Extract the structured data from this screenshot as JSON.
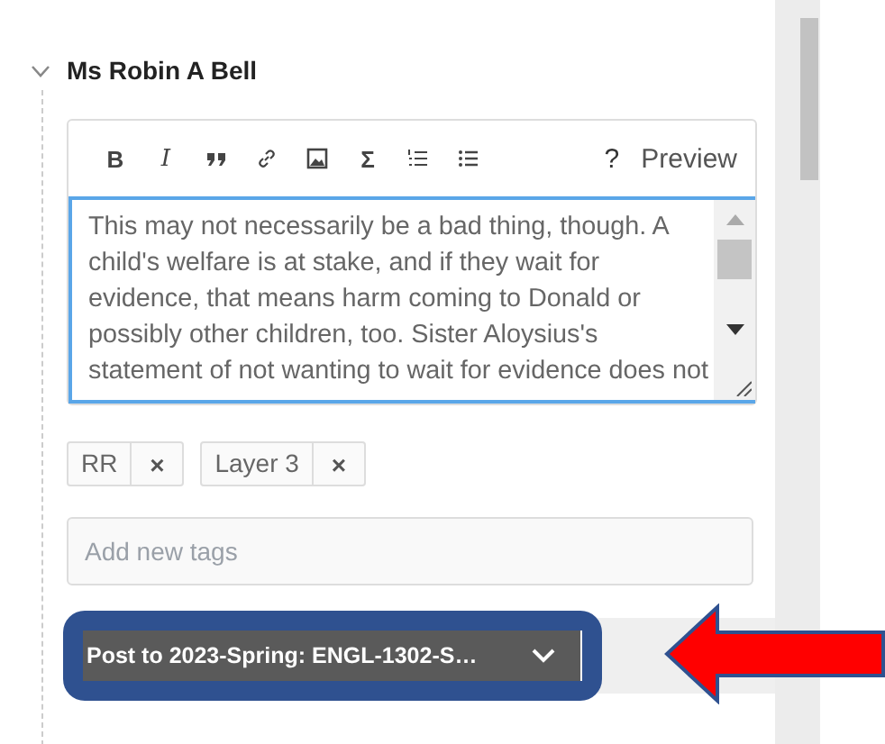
{
  "comment_author": {
    "name": "Ms Robin A Bell",
    "expanded": true
  },
  "toolbar": [
    {
      "kind": "bold",
      "label": "B"
    },
    {
      "kind": "italic",
      "label": "I"
    },
    {
      "kind": "quote"
    },
    {
      "kind": "link"
    },
    {
      "kind": "image"
    },
    {
      "kind": "text",
      "label": "Σ"
    },
    {
      "kind": "ordered-list"
    },
    {
      "kind": "bullet-list"
    }
  ],
  "help": "?",
  "preview": "Preview",
  "body": "This may not necessarily be a bad thing, though. A child's welfare is at stake, and if they wait for evidence, that means harm coming to Donald or possibly other children, too. Sister Aloysius's statement of not wanting to wait for evidence does not",
  "tags": [
    {
      "label": "RR",
      "remove": "×"
    },
    {
      "label": "Layer 3",
      "remove": "×"
    }
  ],
  "tag_input": {
    "placeholder": "Add new tags"
  },
  "post_button": {
    "label": "Post to 2023-Spring: ENGL-1302-S…",
    "highlighted": true
  },
  "annotation_arrow": true
}
